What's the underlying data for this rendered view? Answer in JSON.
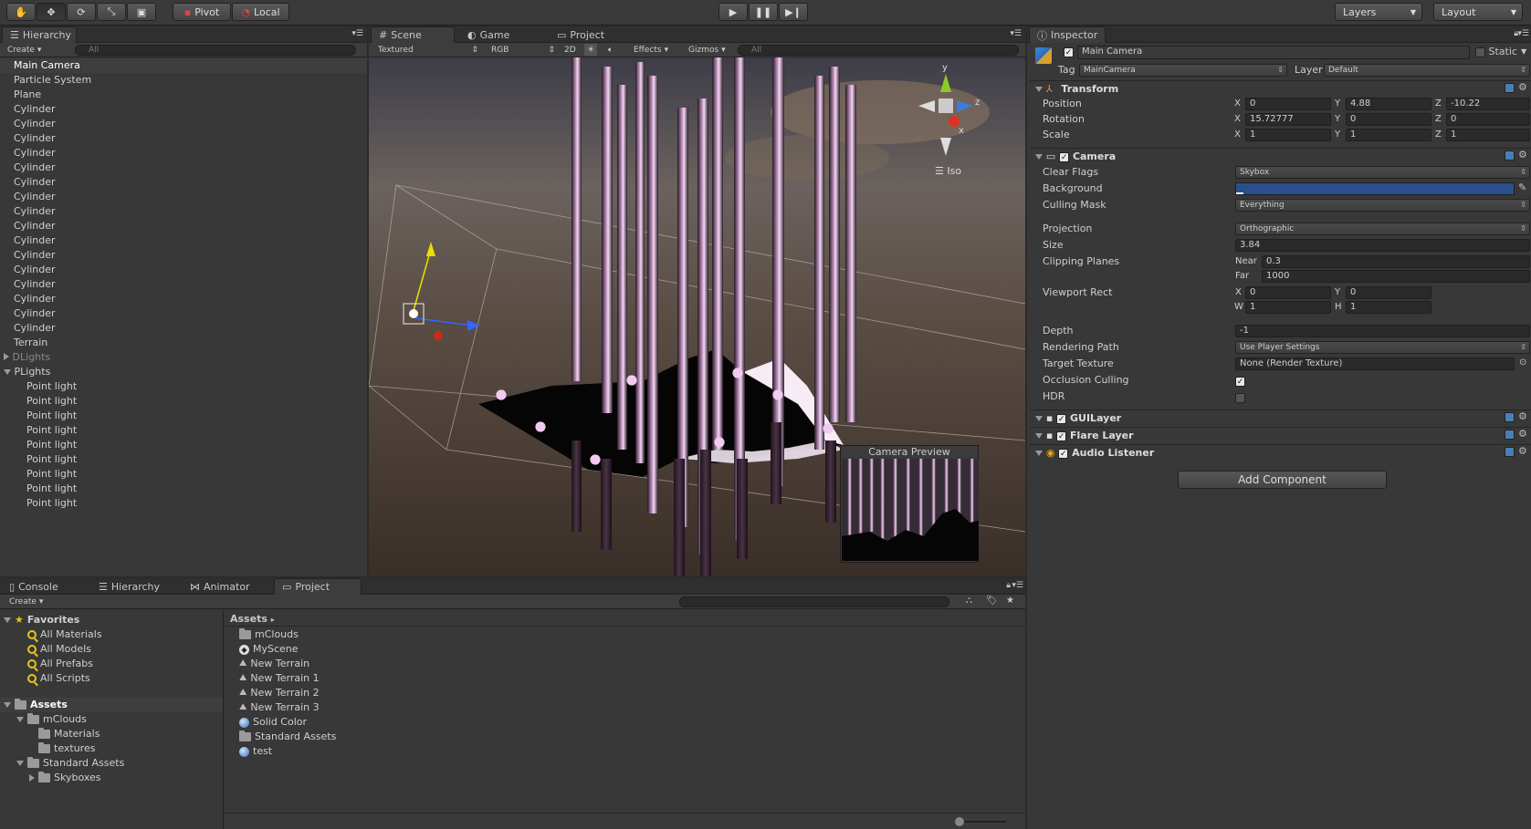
{
  "toolbar": {
    "pivot": "Pivot",
    "local": "Local",
    "layers": "Layers",
    "layout": "Layout"
  },
  "hierarchy": {
    "tab": "Hierarchy",
    "create": "Create",
    "search": "All",
    "items": [
      "Main Camera",
      "Particle System",
      "Plane",
      "Cylinder",
      "Cylinder",
      "Cylinder",
      "Cylinder",
      "Cylinder",
      "Cylinder",
      "Cylinder",
      "Cylinder",
      "Cylinder",
      "Cylinder",
      "Cylinder",
      "Cylinder",
      "Cylinder",
      "Cylinder",
      "Cylinder",
      "Cylinder",
      "Terrain",
      "DLights",
      "PLights"
    ],
    "point_lights": [
      "Point light",
      "Point light",
      "Point light",
      "Point light",
      "Point light",
      "Point light",
      "Point light",
      "Point light",
      "Point light"
    ]
  },
  "scene": {
    "tabs": [
      "Scene",
      "Game",
      "Project"
    ],
    "shading": "Textured",
    "color": "RGB",
    "mode2d": "2D",
    "effects": "Effects",
    "gizmos": "Gizmos",
    "search": "All",
    "iso": "Iso",
    "preview_title": "Camera Preview",
    "axis_y": "y",
    "axis_x": "x",
    "axis_z": "z"
  },
  "inspector": {
    "tab": "Inspector",
    "name": "Main Camera",
    "static": "Static",
    "tag_label": "Tag",
    "tag": "MainCamera",
    "layer_label": "Layer",
    "layer": "Default",
    "transform": "Transform",
    "position": "Position",
    "rotation": "Rotation",
    "scale": "Scale",
    "pos": {
      "x": "0",
      "y": "4.88",
      "z": "-10.22"
    },
    "rot": {
      "x": "15.72777",
      "y": "0",
      "z": "0"
    },
    "scl": {
      "x": "1",
      "y": "1",
      "z": "1"
    },
    "camera": "Camera",
    "clear_flags": "Clear Flags",
    "clear_flags_val": "Skybox",
    "background": "Background",
    "culling_mask": "Culling Mask",
    "culling_val": "Everything",
    "projection": "Projection",
    "projection_val": "Orthographic",
    "size": "Size",
    "size_val": "3.84",
    "clipping": "Clipping Planes",
    "near_label": "Near",
    "near": "0.3",
    "far_label": "Far",
    "far": "1000",
    "viewport": "Viewport Rect",
    "vx": "0",
    "vy": "0",
    "vw": "1",
    "vh": "1",
    "depth": "Depth",
    "depth_val": "-1",
    "rendering_path": "Rendering Path",
    "rendering_val": "Use Player Settings",
    "target_texture": "Target Texture",
    "target_val": "None (Render Texture)",
    "occlusion": "Occlusion Culling",
    "hdr": "HDR",
    "guilayer": "GUILayer",
    "flare": "Flare Layer",
    "audio": "Audio Listener",
    "add_component": "Add Component",
    "x": "X",
    "y": "Y",
    "z": "Z",
    "w": "W",
    "h": "H",
    "bg_color": "#2a4f8f"
  },
  "bottom": {
    "tabs": [
      "Console",
      "Hierarchy",
      "Animator",
      "Project"
    ],
    "create": "Create",
    "favorites": "Favorites",
    "fav_items": [
      "All Materials",
      "All Models",
      "All Prefabs",
      "All Scripts"
    ],
    "assets": "Assets",
    "tree": [
      "mClouds",
      "Materials",
      "textures",
      "Standard Assets",
      "Skyboxes"
    ],
    "breadcrumb": "Assets",
    "files": [
      "mClouds",
      "MyScene",
      "New Terrain",
      "New Terrain 1",
      "New Terrain 2",
      "New Terrain 3",
      "Solid Color",
      "Standard Assets",
      "test"
    ]
  }
}
